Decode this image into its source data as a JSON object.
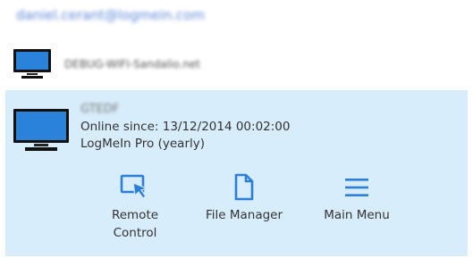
{
  "account": {
    "email": "daniel.cerant@logmein.com"
  },
  "computers": [
    {
      "name": "DEBUG-WIFI-Sandalio.net"
    },
    {
      "name": "GTEDF",
      "status": "Online since: 13/12/2014 00:02:00",
      "subscription": "LogMeIn Pro (yearly)"
    }
  ],
  "actions": [
    {
      "label_line1": "Remote",
      "label_line2": "Control",
      "icon": "remote-control-icon"
    },
    {
      "label": "File Manager",
      "icon": "file-manager-icon"
    },
    {
      "label": "Main Menu",
      "icon": "main-menu-icon"
    }
  ],
  "colors": {
    "accent": "#2d7fd6",
    "selected_bg": "#d8edfb"
  }
}
